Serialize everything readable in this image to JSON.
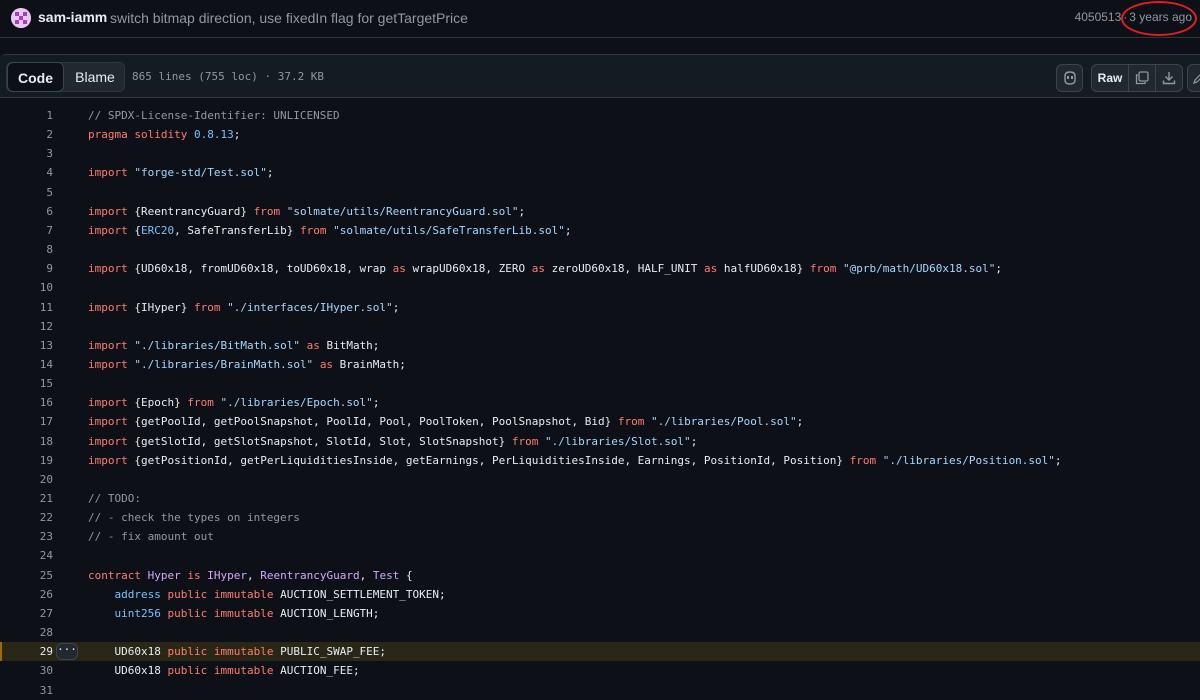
{
  "commit": {
    "author": "sam-iamm",
    "message": "switch bitmap direction, use fixedIn flag for getTargetPrice",
    "sha": "4050513",
    "separator": "·",
    "time": "3 years ago"
  },
  "header": {
    "code_tab": "Code",
    "blame_tab": "Blame",
    "file_info": "865 lines (755 loc) · 37.2 KB",
    "raw_label": "Raw"
  },
  "colors": {
    "keyword": "#ff7b72",
    "string": "#a5d6ff",
    "comment": "#9198a1",
    "type": "#79c0ff",
    "entity": "#d2a8ff",
    "highlight": "#2a2717",
    "annotation": "#e02020"
  },
  "code": {
    "active_line": 29,
    "lines": [
      {
        "n": "1",
        "t": "// SPDX-License-Identifier: UNLICENSED"
      },
      {
        "n": "2",
        "t": "pragma solidity 0.8.13;"
      },
      {
        "n": "3",
        "t": ""
      },
      {
        "n": "4",
        "t": "import \"forge-std/Test.sol\";"
      },
      {
        "n": "5",
        "t": ""
      },
      {
        "n": "6",
        "t": "import {ReentrancyGuard} from \"solmate/utils/ReentrancyGuard.sol\";"
      },
      {
        "n": "7",
        "t": "import {ERC20, SafeTransferLib} from \"solmate/utils/SafeTransferLib.sol\";"
      },
      {
        "n": "8",
        "t": ""
      },
      {
        "n": "9",
        "t": "import {UD60x18, fromUD60x18, toUD60x18, wrap as wrapUD60x18, ZERO as zeroUD60x18, HALF_UNIT as halfUD60x18} from \"@prb/math/UD60x18.sol\";"
      },
      {
        "n": "10",
        "t": ""
      },
      {
        "n": "11",
        "t": "import {IHyper} from \"./interfaces/IHyper.sol\";"
      },
      {
        "n": "12",
        "t": ""
      },
      {
        "n": "13",
        "t": "import \"./libraries/BitMath.sol\" as BitMath;"
      },
      {
        "n": "14",
        "t": "import \"./libraries/BrainMath.sol\" as BrainMath;"
      },
      {
        "n": "15",
        "t": ""
      },
      {
        "n": "16",
        "t": "import {Epoch} from \"./libraries/Epoch.sol\";"
      },
      {
        "n": "17",
        "t": "import {getPoolId, getPoolSnapshot, PoolId, Pool, PoolToken, PoolSnapshot, Bid} from \"./libraries/Pool.sol\";"
      },
      {
        "n": "18",
        "t": "import {getSlotId, getSlotSnapshot, SlotId, Slot, SlotSnapshot} from \"./libraries/Slot.sol\";"
      },
      {
        "n": "19",
        "t": "import {getPositionId, getPerLiquiditiesInside, getEarnings, PerLiquiditiesInside, Earnings, PositionId, Position} from \"./libraries/Position.sol\";"
      },
      {
        "n": "20",
        "t": ""
      },
      {
        "n": "21",
        "t": "// TODO:"
      },
      {
        "n": "22",
        "t": "// - check the types on integers"
      },
      {
        "n": "23",
        "t": "// - fix amount out"
      },
      {
        "n": "24",
        "t": ""
      },
      {
        "n": "25",
        "t": "contract Hyper is IHyper, ReentrancyGuard, Test {"
      },
      {
        "n": "26",
        "t": "    address public immutable AUCTION_SETTLEMENT_TOKEN;"
      },
      {
        "n": "27",
        "t": "    uint256 public immutable AUCTION_LENGTH;"
      },
      {
        "n": "28",
        "t": ""
      },
      {
        "n": "29",
        "t": "    UD60x18 public immutable PUBLIC_SWAP_FEE;"
      },
      {
        "n": "30",
        "t": "    UD60x18 public immutable AUCTION_FEE;"
      },
      {
        "n": "31",
        "t": ""
      }
    ]
  }
}
